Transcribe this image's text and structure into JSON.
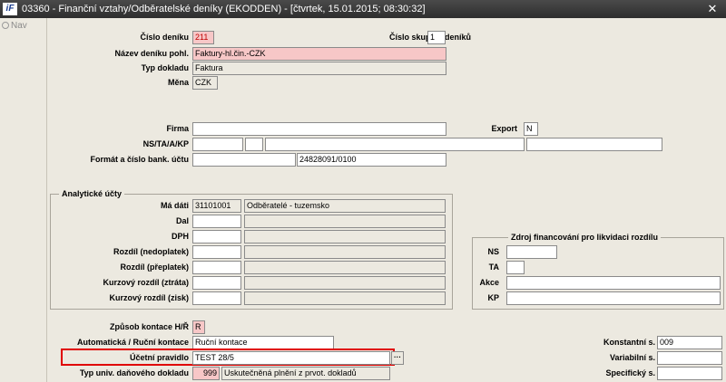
{
  "window": {
    "title": "03360 - Finanční vztahy/Odběratelské deníky (EKODDEN) - [čtvrtek, 15.01.2015; 08:30:32]",
    "logo": "iF",
    "close": "✕"
  },
  "sidebar": {
    "nav": "Nav"
  },
  "form": {
    "cislo_deniku": {
      "label": "Číslo deníku",
      "value": "211"
    },
    "cislo_skupiny": {
      "label": "Číslo skupiny deníků",
      "value": "1"
    },
    "nazev_deniku": {
      "label": "Název deníku pohl.",
      "value": "Faktury-hl.čin.-CZK"
    },
    "typ_dokladu": {
      "label": "Typ dokladu",
      "value": "Faktura"
    },
    "mena": {
      "label": "Měna",
      "value": "CZK"
    },
    "firma": {
      "label": "Firma",
      "value": ""
    },
    "export": {
      "label": "Export",
      "value": "N"
    },
    "ns_ta_a_kp": {
      "label": "NS/TA/A/KP"
    },
    "format_ucet": {
      "label": "Formát a číslo bank. účtu",
      "value1": "",
      "value2": "24828091/0100"
    },
    "analyticke": {
      "title": "Analytické účty",
      "ma_dati": {
        "label": "Má dáti",
        "code": "31101001",
        "name": "Odběratelé - tuzemsko"
      },
      "dal": {
        "label": "Dal"
      },
      "dph": {
        "label": "DPH"
      },
      "rozdil_nedoplatek": {
        "label": "Rozdíl (nedoplatek)"
      },
      "rozdil_preplatek": {
        "label": "Rozdíl (přeplatek)"
      },
      "kurz_ztrata": {
        "label": "Kurzový rozdíl (ztráta)"
      },
      "kurz_zisk": {
        "label": "Kurzový rozdíl (zisk)"
      }
    },
    "zdroj": {
      "title": "Zdroj financování pro likvidaci rozdílu",
      "ns": {
        "label": "NS"
      },
      "ta": {
        "label": "TA"
      },
      "akce": {
        "label": "Akce"
      },
      "kp": {
        "label": "KP"
      }
    },
    "zpusob_kontace": {
      "label": "Způsob kontace H/Ř",
      "value": "R"
    },
    "auto_rucni": {
      "label": "Automatická / Ruční kontace",
      "value": "Ruční kontace"
    },
    "ucetni_pravidlo": {
      "label": "Účetní pravidlo",
      "value": "TEST 28/5",
      "dots": "···"
    },
    "typ_univ": {
      "label": "Typ univ. daňového dokladu",
      "code": "999",
      "name": "Uskutečněná plnění z prvot. dokladů"
    },
    "konstantni": {
      "label": "Konstantní s.",
      "value": "009"
    },
    "variabilni": {
      "label": "Variabilní s.",
      "value": ""
    },
    "specificky": {
      "label": "Specifický s.",
      "value": ""
    }
  }
}
